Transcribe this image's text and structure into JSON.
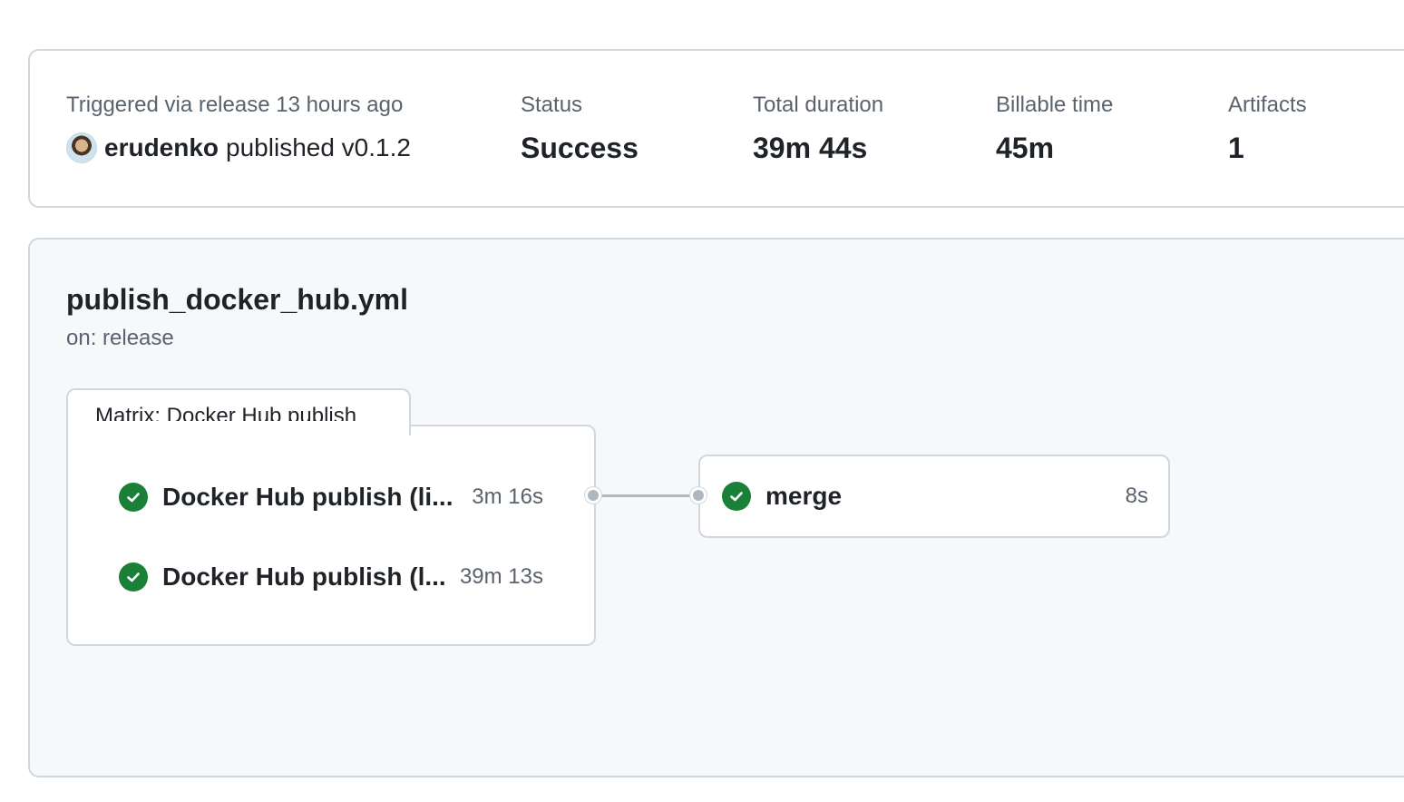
{
  "summary": {
    "trigger_label": "Triggered via release 13 hours ago",
    "actor": "erudenko",
    "action": "published v0.1.2",
    "status_label": "Status",
    "status_value": "Success",
    "duration_label": "Total duration",
    "duration_value": "39m 44s",
    "billable_label": "Billable time",
    "billable_value": "45m",
    "artifacts_label": "Artifacts",
    "artifacts_value": "1"
  },
  "workflow": {
    "file": "publish_docker_hub.yml",
    "trigger": "on: release",
    "matrix": {
      "label": "Matrix: Docker Hub publish",
      "jobs": [
        {
          "name": "Docker Hub publish (li...",
          "duration": "3m 16s",
          "status_icon": "check-circle-icon"
        },
        {
          "name": "Docker Hub publish (l...",
          "duration": "39m 13s",
          "status_icon": "check-circle-icon"
        }
      ]
    },
    "merge_job": {
      "name": "merge",
      "duration": "8s",
      "status_icon": "check-circle-icon"
    }
  },
  "colors": {
    "success": "#1a7f37",
    "border": "#d0d7de",
    "muted_text": "#59636e",
    "graph_bg": "#f6f8fa"
  }
}
